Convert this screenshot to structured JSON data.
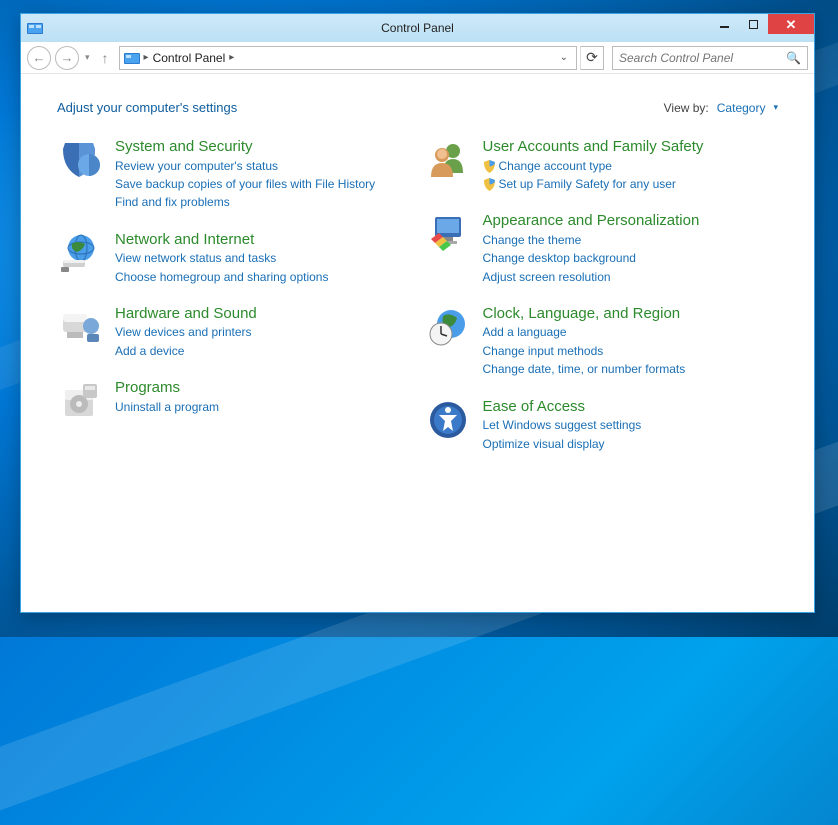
{
  "window": {
    "title": "Control Panel"
  },
  "address": {
    "text": "Control Panel"
  },
  "search": {
    "placeholder": "Search Control Panel"
  },
  "heading": "Adjust your computer's settings",
  "viewby": {
    "label": "View by:",
    "value": "Category"
  },
  "left": [
    {
      "title": "System and Security",
      "links": [
        {
          "text": "Review your computer's status"
        },
        {
          "text": "Save backup copies of your files with File History"
        },
        {
          "text": "Find and fix problems"
        }
      ]
    },
    {
      "title": "Network and Internet",
      "links": [
        {
          "text": "View network status and tasks"
        },
        {
          "text": "Choose homegroup and sharing options"
        }
      ]
    },
    {
      "title": "Hardware and Sound",
      "links": [
        {
          "text": "View devices and printers"
        },
        {
          "text": "Add a device"
        }
      ]
    },
    {
      "title": "Programs",
      "links": [
        {
          "text": "Uninstall a program"
        }
      ]
    }
  ],
  "right": [
    {
      "title": "User Accounts and Family Safety",
      "links": [
        {
          "text": "Change account type",
          "shield": true
        },
        {
          "text": "Set up Family Safety for any user",
          "shield": true
        }
      ]
    },
    {
      "title": "Appearance and Personalization",
      "links": [
        {
          "text": "Change the theme"
        },
        {
          "text": "Change desktop background"
        },
        {
          "text": "Adjust screen resolution"
        }
      ]
    },
    {
      "title": "Clock, Language, and Region",
      "links": [
        {
          "text": "Add a language"
        },
        {
          "text": "Change input methods"
        },
        {
          "text": "Change date, time, or number formats"
        }
      ]
    },
    {
      "title": "Ease of Access",
      "links": [
        {
          "text": "Let Windows suggest settings"
        },
        {
          "text": "Optimize visual display"
        }
      ]
    }
  ]
}
